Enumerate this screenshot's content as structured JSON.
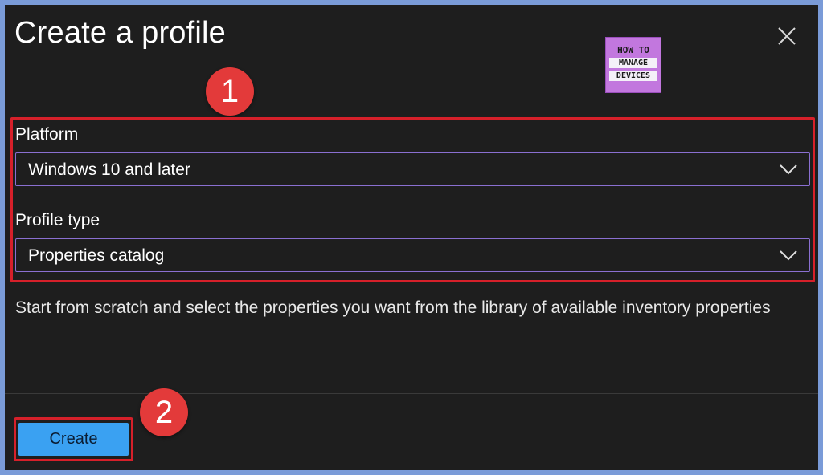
{
  "dialog": {
    "title": "Create a profile",
    "close_icon": "close-icon"
  },
  "logo": {
    "line1": "HOW TO",
    "line2": "MANAGE",
    "line3": "DEVICES"
  },
  "markers": {
    "one": "1",
    "two": "2"
  },
  "form": {
    "platform": {
      "label": "Platform",
      "value": "Windows 10 and later"
    },
    "profile_type": {
      "label": "Profile type",
      "value": "Properties catalog"
    },
    "description": "Start from scratch and select the properties you want from the library of available inventory properties"
  },
  "footer": {
    "create_label": "Create"
  },
  "colors": {
    "panel_bg": "#1e1e1e",
    "frame_bg": "#7a9bd8",
    "accent_button": "#3aa1f2",
    "highlight_red": "#d6202a",
    "marker_red": "#e33a3a",
    "select_border": "#8a6fd1",
    "logo_bg": "#c277de"
  }
}
